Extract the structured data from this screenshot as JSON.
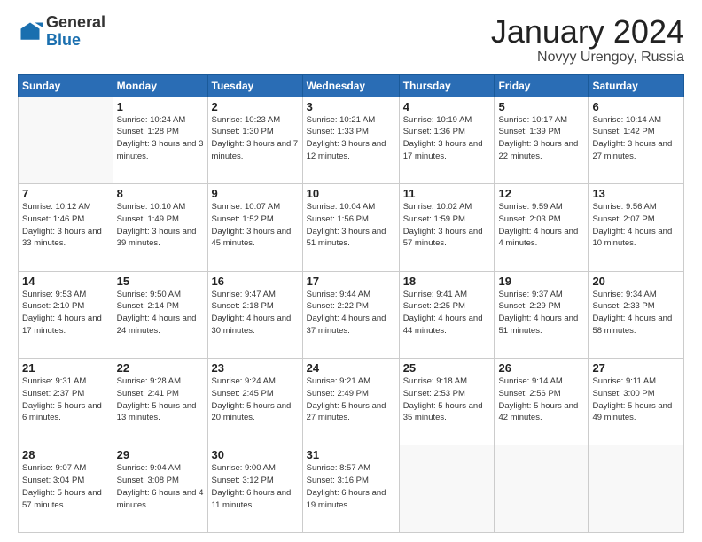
{
  "header": {
    "logo_general": "General",
    "logo_blue": "Blue",
    "title": "January 2024",
    "location": "Novyy Urengoy, Russia"
  },
  "days_of_week": [
    "Sunday",
    "Monday",
    "Tuesday",
    "Wednesday",
    "Thursday",
    "Friday",
    "Saturday"
  ],
  "weeks": [
    [
      {
        "day": "",
        "empty": true
      },
      {
        "day": "1",
        "sunrise": "Sunrise: 10:24 AM",
        "sunset": "Sunset: 1:28 PM",
        "daylight": "Daylight: 3 hours and 3 minutes."
      },
      {
        "day": "2",
        "sunrise": "Sunrise: 10:23 AM",
        "sunset": "Sunset: 1:30 PM",
        "daylight": "Daylight: 3 hours and 7 minutes."
      },
      {
        "day": "3",
        "sunrise": "Sunrise: 10:21 AM",
        "sunset": "Sunset: 1:33 PM",
        "daylight": "Daylight: 3 hours and 12 minutes."
      },
      {
        "day": "4",
        "sunrise": "Sunrise: 10:19 AM",
        "sunset": "Sunset: 1:36 PM",
        "daylight": "Daylight: 3 hours and 17 minutes."
      },
      {
        "day": "5",
        "sunrise": "Sunrise: 10:17 AM",
        "sunset": "Sunset: 1:39 PM",
        "daylight": "Daylight: 3 hours and 22 minutes."
      },
      {
        "day": "6",
        "sunrise": "Sunrise: 10:14 AM",
        "sunset": "Sunset: 1:42 PM",
        "daylight": "Daylight: 3 hours and 27 minutes."
      }
    ],
    [
      {
        "day": "7",
        "sunrise": "Sunrise: 10:12 AM",
        "sunset": "Sunset: 1:46 PM",
        "daylight": "Daylight: 3 hours and 33 minutes."
      },
      {
        "day": "8",
        "sunrise": "Sunrise: 10:10 AM",
        "sunset": "Sunset: 1:49 PM",
        "daylight": "Daylight: 3 hours and 39 minutes."
      },
      {
        "day": "9",
        "sunrise": "Sunrise: 10:07 AM",
        "sunset": "Sunset: 1:52 PM",
        "daylight": "Daylight: 3 hours and 45 minutes."
      },
      {
        "day": "10",
        "sunrise": "Sunrise: 10:04 AM",
        "sunset": "Sunset: 1:56 PM",
        "daylight": "Daylight: 3 hours and 51 minutes."
      },
      {
        "day": "11",
        "sunrise": "Sunrise: 10:02 AM",
        "sunset": "Sunset: 1:59 PM",
        "daylight": "Daylight: 3 hours and 57 minutes."
      },
      {
        "day": "12",
        "sunrise": "Sunrise: 9:59 AM",
        "sunset": "Sunset: 2:03 PM",
        "daylight": "Daylight: 4 hours and 4 minutes."
      },
      {
        "day": "13",
        "sunrise": "Sunrise: 9:56 AM",
        "sunset": "Sunset: 2:07 PM",
        "daylight": "Daylight: 4 hours and 10 minutes."
      }
    ],
    [
      {
        "day": "14",
        "sunrise": "Sunrise: 9:53 AM",
        "sunset": "Sunset: 2:10 PM",
        "daylight": "Daylight: 4 hours and 17 minutes."
      },
      {
        "day": "15",
        "sunrise": "Sunrise: 9:50 AM",
        "sunset": "Sunset: 2:14 PM",
        "daylight": "Daylight: 4 hours and 24 minutes."
      },
      {
        "day": "16",
        "sunrise": "Sunrise: 9:47 AM",
        "sunset": "Sunset: 2:18 PM",
        "daylight": "Daylight: 4 hours and 30 minutes."
      },
      {
        "day": "17",
        "sunrise": "Sunrise: 9:44 AM",
        "sunset": "Sunset: 2:22 PM",
        "daylight": "Daylight: 4 hours and 37 minutes."
      },
      {
        "day": "18",
        "sunrise": "Sunrise: 9:41 AM",
        "sunset": "Sunset: 2:25 PM",
        "daylight": "Daylight: 4 hours and 44 minutes."
      },
      {
        "day": "19",
        "sunrise": "Sunrise: 9:37 AM",
        "sunset": "Sunset: 2:29 PM",
        "daylight": "Daylight: 4 hours and 51 minutes."
      },
      {
        "day": "20",
        "sunrise": "Sunrise: 9:34 AM",
        "sunset": "Sunset: 2:33 PM",
        "daylight": "Daylight: 4 hours and 58 minutes."
      }
    ],
    [
      {
        "day": "21",
        "sunrise": "Sunrise: 9:31 AM",
        "sunset": "Sunset: 2:37 PM",
        "daylight": "Daylight: 5 hours and 6 minutes."
      },
      {
        "day": "22",
        "sunrise": "Sunrise: 9:28 AM",
        "sunset": "Sunset: 2:41 PM",
        "daylight": "Daylight: 5 hours and 13 minutes."
      },
      {
        "day": "23",
        "sunrise": "Sunrise: 9:24 AM",
        "sunset": "Sunset: 2:45 PM",
        "daylight": "Daylight: 5 hours and 20 minutes."
      },
      {
        "day": "24",
        "sunrise": "Sunrise: 9:21 AM",
        "sunset": "Sunset: 2:49 PM",
        "daylight": "Daylight: 5 hours and 27 minutes."
      },
      {
        "day": "25",
        "sunrise": "Sunrise: 9:18 AM",
        "sunset": "Sunset: 2:53 PM",
        "daylight": "Daylight: 5 hours and 35 minutes."
      },
      {
        "day": "26",
        "sunrise": "Sunrise: 9:14 AM",
        "sunset": "Sunset: 2:56 PM",
        "daylight": "Daylight: 5 hours and 42 minutes."
      },
      {
        "day": "27",
        "sunrise": "Sunrise: 9:11 AM",
        "sunset": "Sunset: 3:00 PM",
        "daylight": "Daylight: 5 hours and 49 minutes."
      }
    ],
    [
      {
        "day": "28",
        "sunrise": "Sunrise: 9:07 AM",
        "sunset": "Sunset: 3:04 PM",
        "daylight": "Daylight: 5 hours and 57 minutes."
      },
      {
        "day": "29",
        "sunrise": "Sunrise: 9:04 AM",
        "sunset": "Sunset: 3:08 PM",
        "daylight": "Daylight: 6 hours and 4 minutes."
      },
      {
        "day": "30",
        "sunrise": "Sunrise: 9:00 AM",
        "sunset": "Sunset: 3:12 PM",
        "daylight": "Daylight: 6 hours and 11 minutes."
      },
      {
        "day": "31",
        "sunrise": "Sunrise: 8:57 AM",
        "sunset": "Sunset: 3:16 PM",
        "daylight": "Daylight: 6 hours and 19 minutes."
      },
      {
        "day": "",
        "empty": true
      },
      {
        "day": "",
        "empty": true
      },
      {
        "day": "",
        "empty": true
      }
    ]
  ]
}
